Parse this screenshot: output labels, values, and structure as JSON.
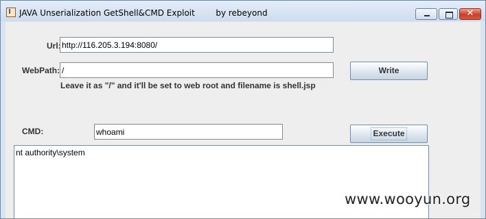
{
  "window": {
    "title": "JAVA Unserialization GetShell&CMD Exploit",
    "author": "by rebeyond",
    "icon": "java-cup-icon",
    "controls": {
      "minimize": "minimize-icon",
      "maximize": "maximize-icon",
      "close": "close-icon",
      "close_glyph": "✕"
    }
  },
  "form": {
    "url_label": "Url:",
    "url_value": "http://116.205.3.194:8080/",
    "webpath_label": "WebPath:",
    "webpath_value": "/",
    "write_button": "Write",
    "hint": "Leave it as \"/\" and it'll be set to web root and filename is shell.jsp",
    "cmd_label": "CMD:",
    "cmd_value": "whoami",
    "execute_button": "Execute"
  },
  "output": {
    "text": "nt authority\\system"
  },
  "watermark": "www.wooyun.org"
}
